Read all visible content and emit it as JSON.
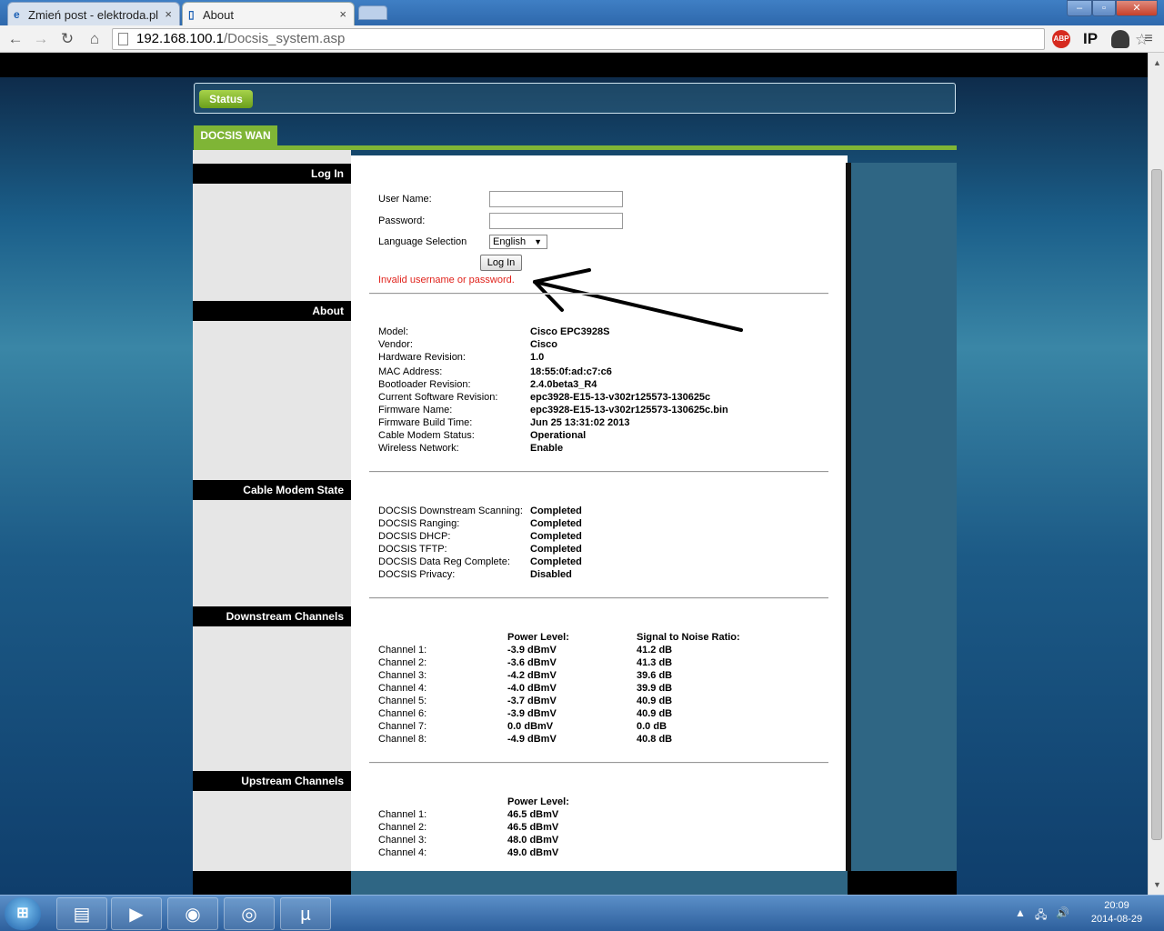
{
  "browser": {
    "tabs": [
      {
        "label": "Zmień post - elektroda.pl",
        "close": "×"
      },
      {
        "label": "About",
        "close": "×"
      }
    ],
    "url_host": "192.168.100.1",
    "url_path": "/Docsis_system.asp",
    "window_buttons": {
      "minimize": "–",
      "maximize": "▫",
      "close": "✕"
    },
    "extensions": {
      "abp": "ABP",
      "ip": "IP"
    },
    "icons": {
      "back": "←",
      "forward": "→",
      "reload": "↻",
      "home": "⌂",
      "star": "☆",
      "menu": "≡"
    }
  },
  "page": {
    "status_button": "Status",
    "section_tab": "DOCSIS WAN",
    "sections": {
      "login": "Log In",
      "about": "About",
      "cable_modem_state": "Cable Modem State",
      "downstream": "Downstream Channels",
      "upstream": "Upstream Channels"
    },
    "login": {
      "username_label": "User Name:",
      "password_label": "Password:",
      "language_label": "Language Selection",
      "language_value": "English",
      "submit": "Log In",
      "error": "Invalid username or password."
    },
    "about": [
      {
        "label": "Model:",
        "value": "Cisco EPC3928S"
      },
      {
        "label": "Vendor:",
        "value": "Cisco"
      },
      {
        "label": "Hardware Revision:",
        "value": "1.0"
      },
      {
        "label": "MAC Address:",
        "value": "18:55:0f:ad:c7:c6"
      },
      {
        "label": "Bootloader Revision:",
        "value": "2.4.0beta3_R4"
      },
      {
        "label": "Current Software Revision:",
        "value": "epc3928-E15-13-v302r125573-130625c"
      },
      {
        "label": "Firmware Name:",
        "value": "epc3928-E15-13-v302r125573-130625c.bin"
      },
      {
        "label": "Firmware Build Time:",
        "value": "Jun 25 13:31:02 2013"
      },
      {
        "label": "Cable Modem Status:",
        "value": "Operational"
      },
      {
        "label": "Wireless Network:",
        "value": "Enable"
      }
    ],
    "cable_modem_state": [
      {
        "label": "DOCSIS Downstream Scanning:",
        "value": "Completed"
      },
      {
        "label": "DOCSIS Ranging:",
        "value": "Completed"
      },
      {
        "label": "DOCSIS DHCP:",
        "value": "Completed"
      },
      {
        "label": "DOCSIS TFTP:",
        "value": "Completed"
      },
      {
        "label": "DOCSIS Data Reg Complete:",
        "value": "Completed"
      },
      {
        "label": "DOCSIS Privacy:",
        "value": "Disabled"
      }
    ],
    "downstream": {
      "power_header": "Power Level:",
      "snr_header": "Signal to Noise Ratio:",
      "rows": [
        {
          "channel": "Channel 1:",
          "power": "-3.9 dBmV",
          "snr": "41.2 dB"
        },
        {
          "channel": "Channel 2:",
          "power": "-3.6 dBmV",
          "snr": "41.3 dB"
        },
        {
          "channel": "Channel 3:",
          "power": "-4.2 dBmV",
          "snr": "39.6 dB"
        },
        {
          "channel": "Channel 4:",
          "power": "-4.0 dBmV",
          "snr": "39.9 dB"
        },
        {
          "channel": "Channel 5:",
          "power": "-3.7 dBmV",
          "snr": "40.9 dB"
        },
        {
          "channel": "Channel 6:",
          "power": "-3.9 dBmV",
          "snr": "40.9 dB"
        },
        {
          "channel": "Channel 7:",
          "power": "0.0 dBmV",
          "snr": "0.0 dB"
        },
        {
          "channel": "Channel 8:",
          "power": "-4.9 dBmV",
          "snr": "40.8 dB"
        }
      ]
    },
    "upstream": {
      "power_header": "Power Level:",
      "rows": [
        {
          "channel": "Channel 1:",
          "power": "46.5 dBmV"
        },
        {
          "channel": "Channel 2:",
          "power": "46.5 dBmV"
        },
        {
          "channel": "Channel 3:",
          "power": "48.0 dBmV"
        },
        {
          "channel": "Channel 4:",
          "power": "49.0 dBmV"
        }
      ]
    }
  },
  "taskbar": {
    "start": "⊞",
    "apps": [
      "folder",
      "media-player",
      "steam",
      "chrome",
      "utorrent"
    ],
    "tray": {
      "up": "▲",
      "net": "🖧",
      "vol": "🔊"
    },
    "time": "20:09",
    "date": "2014-08-29"
  },
  "colors": {
    "accent_green": "#7fb536",
    "error_red": "#e0231c",
    "panel_teal": "#2f6684"
  }
}
